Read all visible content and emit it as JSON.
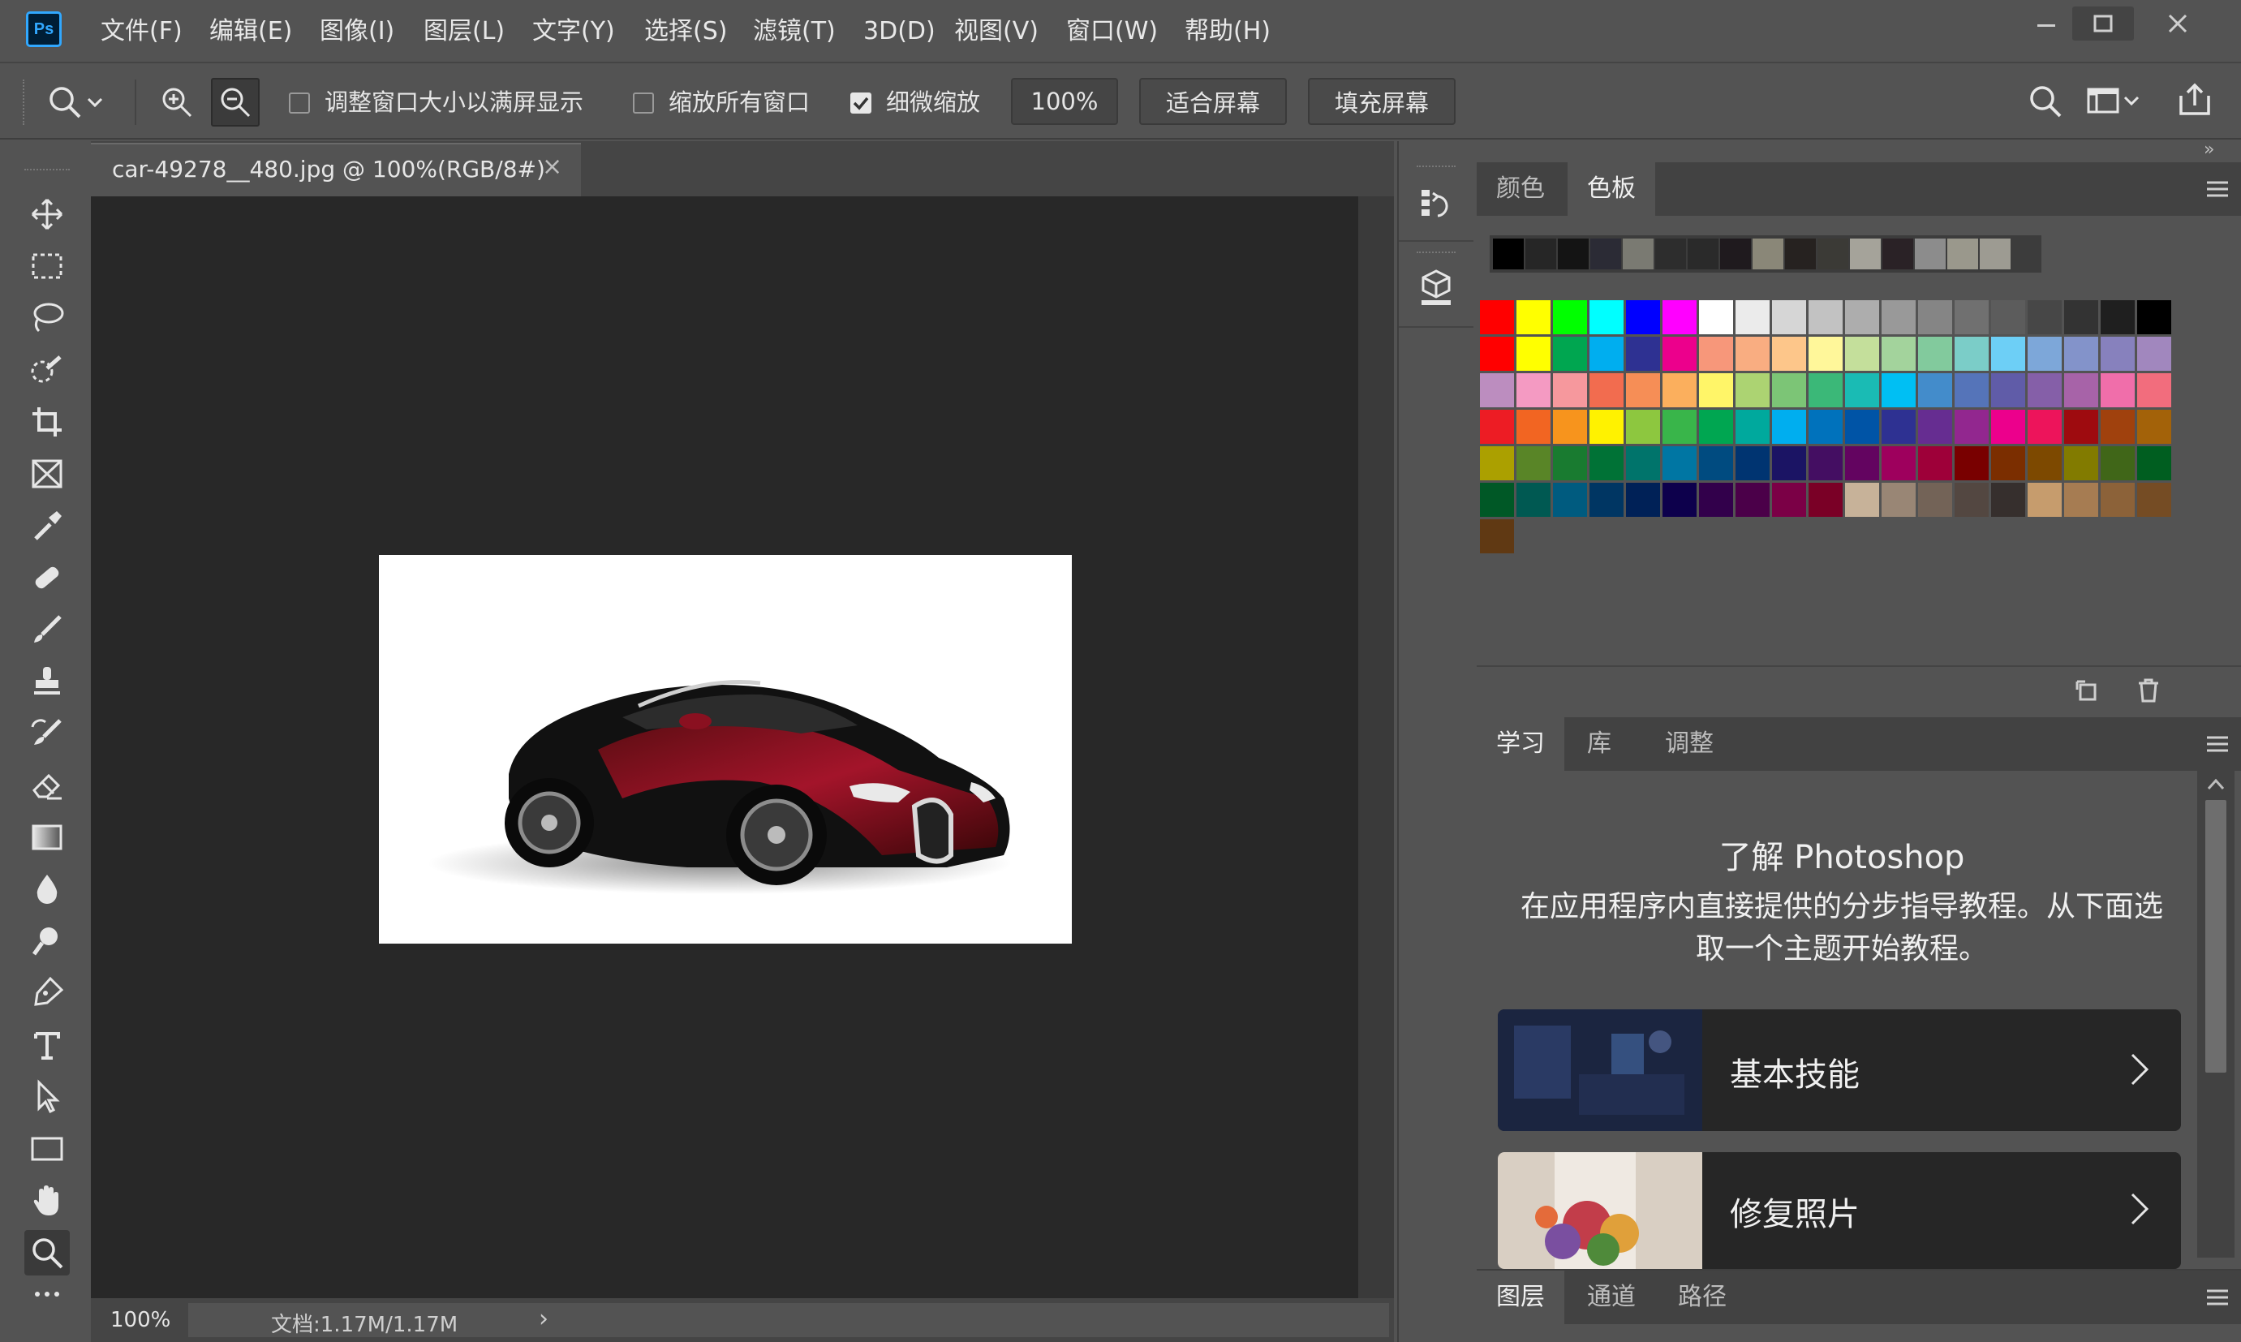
{
  "app": {
    "logo": "Ps"
  },
  "menu": [
    "文件(F)",
    "编辑(E)",
    "图像(I)",
    "图层(L)",
    "文字(Y)",
    "选择(S)",
    "滤镜(T)",
    "3D(D)",
    "视图(V)",
    "窗口(W)",
    "帮助(H)"
  ],
  "options": {
    "resize_windows": {
      "label": "调整窗口大小以满屏显示",
      "checked": false
    },
    "zoom_all": {
      "label": "缩放所有窗口",
      "checked": false
    },
    "scrubby": {
      "label": "细微缩放",
      "checked": true
    },
    "zoom_value": "100%",
    "fit_screen": "适合屏幕",
    "fill_screen": "填充屏幕"
  },
  "document": {
    "tab_title": "car-49278__480.jpg @ 100%(RGB/8#)",
    "close_glyph": "×",
    "status_zoom": "100%",
    "status_doc": "文档:1.17M/1.17M",
    "status_arrow": "›"
  },
  "swatch_panel": {
    "tabs": [
      "颜色",
      "色板"
    ],
    "active_tab": "色板",
    "recent": [
      "#000000",
      "#262626",
      "#141414",
      "#2b2b35",
      "#7a7a72",
      "#2d2d2d",
      "#2a2a2a",
      "#1f1a1e",
      "#8a8778",
      "#262220",
      "#3b3a36",
      "#a5a39a",
      "#2a2226",
      "#8c8c8c",
      "#9a988c",
      "#9d9b92"
    ],
    "grid": [
      "#ff0000",
      "#ffff00",
      "#00ff00",
      "#00ffff",
      "#0000ff",
      "#ff00ff",
      "#ffffff",
      "#ebebeb",
      "#d6d6d6",
      "#c2c2c2",
      "#adadad",
      "#999999",
      "#858585",
      "#707070",
      "#5c5c5c",
      "#474747",
      "#333333",
      "#1f1f1f",
      "#000000",
      "#ff0000",
      "#ffff00",
      "#00a650",
      "#00aeef",
      "#2e3192",
      "#ec008c",
      "#f7977a",
      "#f9ad81",
      "#fdc68a",
      "#fff79a",
      "#c4df9b",
      "#a3d39c",
      "#82ca9d",
      "#7bcdc8",
      "#6dcff6",
      "#7da7d9",
      "#8393ca",
      "#8781bd",
      "#a187be",
      "#bc8dbf",
      "#f49ac2",
      "#f6989d",
      "#f26c4f",
      "#f68e56",
      "#fbaf5d",
      "#fff568",
      "#acd372",
      "#7cc576",
      "#3bb878",
      "#1abbb4",
      "#00bff3",
      "#438ccb",
      "#5574b9",
      "#605ca8",
      "#855fa8",
      "#a763a8",
      "#f06eaa",
      "#f26d7d",
      "#ed1c24",
      "#f26522",
      "#f7941d",
      "#fff200",
      "#8dc73f",
      "#39b54a",
      "#00a651",
      "#00a99d",
      "#00aeef",
      "#0072bc",
      "#0054a6",
      "#2e3192",
      "#662d91",
      "#92278f",
      "#ec008c",
      "#ed145b",
      "#9e0b0f",
      "#a0410d",
      "#a36209",
      "#aba000",
      "#598527",
      "#197b30",
      "#007236",
      "#00746b",
      "#0076a3",
      "#004b80",
      "#003471",
      "#1b1464",
      "#440e62",
      "#630460",
      "#9e005d",
      "#9e0039",
      "#790000",
      "#7b2e00",
      "#7d4900",
      "#827b00",
      "#406618",
      "#005e20",
      "#005826",
      "#005952",
      "#005b7f",
      "#003663",
      "#002157",
      "#0d004c",
      "#32004b",
      "#4b0049",
      "#7b0046",
      "#7a0026",
      "#c7b299",
      "#998675",
      "#736357",
      "#534741",
      "#362f2d",
      "#c69c6d",
      "#a67c52",
      "#8c6239",
      "#754c24",
      "#603913"
    ]
  },
  "learn_panel": {
    "tabs": [
      "学习",
      "库",
      "调整"
    ],
    "active_tab": "学习",
    "title": "了解 Photoshop",
    "description": "在应用程序内直接提供的分步指导教程。从下面选取一个主题开始教程。",
    "cards": [
      "基本技能",
      "修复照片"
    ]
  },
  "layers_panel": {
    "tabs": [
      "图层",
      "通道",
      "路径"
    ],
    "active_tab": "图层"
  },
  "colors": {
    "chrome": "#535353",
    "canvas": "#282828",
    "accent": "#31a8ff"
  }
}
